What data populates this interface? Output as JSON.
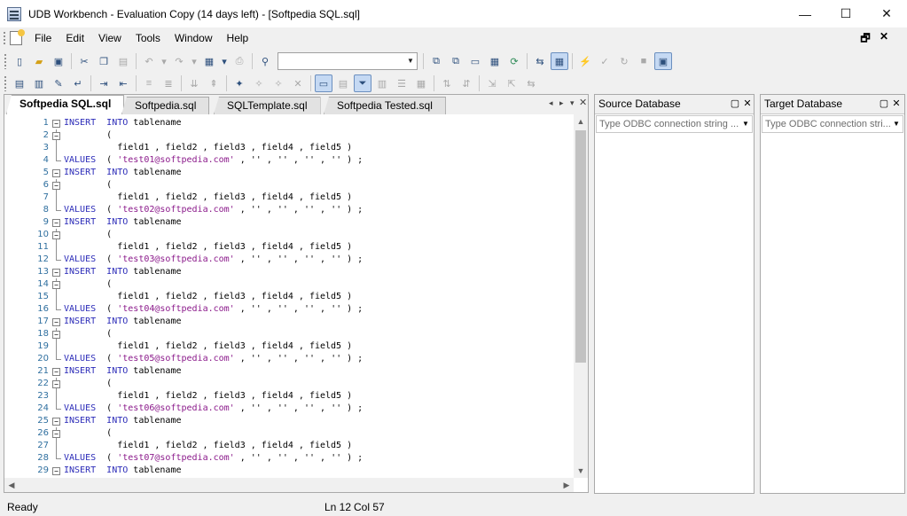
{
  "window": {
    "title": "UDB Workbench - Evaluation Copy (14 days left) - [Softpedia SQL.sql]",
    "minimize": "—",
    "maximize": "☐",
    "close": "✕"
  },
  "menu": {
    "items": [
      "File",
      "Edit",
      "View",
      "Tools",
      "Window",
      "Help"
    ],
    "mdi_restore": "🗗",
    "mdi_close": "✕"
  },
  "toolbar": {
    "search_combo_value": ""
  },
  "tabs": [
    {
      "label": "Softpedia SQL.sql",
      "active": true
    },
    {
      "label": "Softpedia.sql",
      "active": false
    },
    {
      "label": "SQLTemplate.sql",
      "active": false
    },
    {
      "label": "Softpedia Tested.sql",
      "active": false
    }
  ],
  "editor": {
    "blocks": [
      {
        "insert": "INSERT",
        "into": "INTO",
        "table": "tablename",
        "open_paren": "(",
        "fields": "field1 , field2 , field3 , field4 , field5 )",
        "values_kw": "VALUES",
        "paren": "(",
        "value": "'test01@softpedia.com'",
        "rest": ", '' , '' , '' , '' ) ;"
      },
      {
        "insert": "INSERT",
        "into": "INTO",
        "table": "tablename",
        "open_paren": "(",
        "fields": "field1 , field2 , field3 , field4 , field5 )",
        "values_kw": "VALUES",
        "paren": "(",
        "value": "'test02@softpedia.com'",
        "rest": ", '' , '' , '' , '' ) ;"
      },
      {
        "insert": "INSERT",
        "into": "INTO",
        "table": "tablename",
        "open_paren": "(",
        "fields": "field1 , field2 , field3 , field4 , field5 )",
        "values_kw": "VALUES",
        "paren": "(",
        "value": "'test03@softpedia.com'",
        "rest": ", '' , '' , '' , '' ) ;"
      },
      {
        "insert": "INSERT",
        "into": "INTO",
        "table": "tablename",
        "open_paren": "(",
        "fields": "field1 , field2 , field3 , field4 , field5 )",
        "values_kw": "VALUES",
        "paren": "(",
        "value": "'test04@softpedia.com'",
        "rest": ", '' , '' , '' , '' ) ;"
      },
      {
        "insert": "INSERT",
        "into": "INTO",
        "table": "tablename",
        "open_paren": "(",
        "fields": "field1 , field2 , field3 , field4 , field5 )",
        "values_kw": "VALUES",
        "paren": "(",
        "value": "'test05@softpedia.com'",
        "rest": ", '' , '' , '' , '' ) ;"
      },
      {
        "insert": "INSERT",
        "into": "INTO",
        "table": "tablename",
        "open_paren": "(",
        "fields": "field1 , field2 , field3 , field4 , field5 )",
        "values_kw": "VALUES",
        "paren": "(",
        "value": "'test06@softpedia.com'",
        "rest": ", '' , '' , '' , '' ) ;"
      },
      {
        "insert": "INSERT",
        "into": "INTO",
        "table": "tablename",
        "open_paren": "(",
        "fields": "field1 , field2 , field3 , field4 , field5 )",
        "values_kw": "VALUES",
        "paren": "(",
        "value": "'test07@softpedia.com'",
        "rest": ", '' , '' , '' , '' ) ;"
      },
      {
        "insert": "INSERT",
        "into": "INTO",
        "table": "tablename"
      }
    ],
    "line_numbers": [
      "1",
      "2",
      "3",
      "4",
      "5",
      "6",
      "7",
      "8",
      "9",
      "10",
      "11",
      "12",
      "13",
      "14",
      "15",
      "16",
      "17",
      "18",
      "19",
      "20",
      "21",
      "22",
      "23",
      "24",
      "25",
      "26",
      "27",
      "28",
      "29"
    ]
  },
  "source_panel": {
    "title": "Source Database",
    "placeholder": "Type ODBC connection string ..."
  },
  "target_panel": {
    "title": "Target Database",
    "placeholder": "Type ODBC connection stri..."
  },
  "status": {
    "state": "Ready",
    "line": "Ln 12",
    "col": "Col 57"
  }
}
